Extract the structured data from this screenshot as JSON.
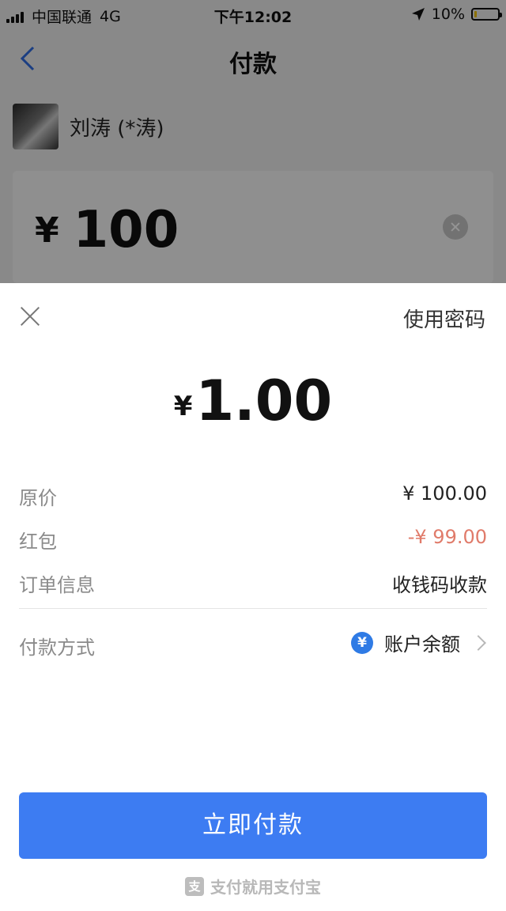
{
  "status_bar": {
    "carrier": "中国联通",
    "network": "4G",
    "time": "下午12:02",
    "battery": "10%",
    "battery_level": 0.1
  },
  "nav": {
    "title": "付款"
  },
  "payee": {
    "name": "刘涛 (*涛)"
  },
  "amount_input": {
    "currency": "¥",
    "value": "100"
  },
  "sheet": {
    "use_password": "使用密码",
    "amount_currency": "¥",
    "amount": "1.00",
    "details": [
      {
        "label": "原价",
        "value": "¥ 100.00"
      },
      {
        "label": "红包",
        "value": "-¥ 99.00"
      },
      {
        "label": "订单信息",
        "value": "收钱码收款"
      }
    ],
    "payment_method": {
      "label": "付款方式",
      "icon_glyph": "¥",
      "value": "账户余额"
    },
    "pay_button": "立即付款",
    "footer": "支付就用支付宝",
    "footer_logo_glyph": "支"
  },
  "colors": {
    "accent": "#3d7cf2",
    "discount": "#e07b6a",
    "method_icon": "#2f7be5"
  },
  "icons": [
    "signal-icon",
    "location-icon",
    "battery-icon",
    "back-icon",
    "clear-icon",
    "close-icon",
    "yuan-icon",
    "chevron-right-icon",
    "alipay-logo-icon"
  ]
}
